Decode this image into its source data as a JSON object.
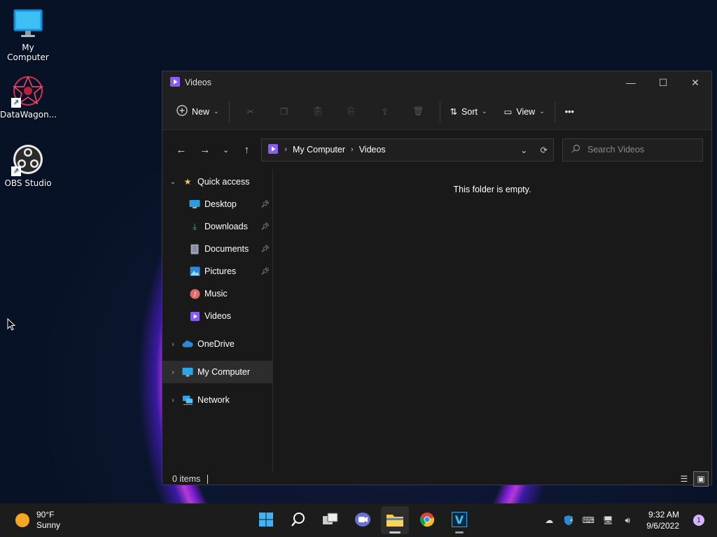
{
  "desktop": {
    "icons": [
      {
        "label": "My Computer",
        "icon": "monitor-icon"
      },
      {
        "label": "DataWagon...",
        "icon": "datawagon-app-icon"
      },
      {
        "label": "OBS Studio",
        "icon": "obs-studio-icon"
      }
    ]
  },
  "window": {
    "title": "Videos",
    "title_icon": "videos-folder-icon",
    "controls": {
      "minimize": "—",
      "maximize": "☐",
      "close": "✕"
    },
    "commandbar": {
      "new_label": "New",
      "sort_label": "Sort",
      "view_label": "View",
      "more_label": "•••",
      "disabled_actions": [
        "cut-icon",
        "copy-icon",
        "paste-icon",
        "rename-icon",
        "share-icon",
        "delete-icon"
      ]
    },
    "address": {
      "crumbs": [
        "My Computer",
        "Videos"
      ],
      "separator": "›"
    },
    "search": {
      "placeholder": "Search Videos"
    },
    "navpane": {
      "quick_access": "Quick access",
      "items": [
        {
          "label": "Desktop",
          "icon": "desktop-folder-icon",
          "pinned": true
        },
        {
          "label": "Downloads",
          "icon": "downloads-folder-icon",
          "pinned": true
        },
        {
          "label": "Documents",
          "icon": "documents-folder-icon",
          "pinned": true
        },
        {
          "label": "Pictures",
          "icon": "pictures-folder-icon",
          "pinned": true
        },
        {
          "label": "Music",
          "icon": "music-folder-icon",
          "pinned": false
        },
        {
          "label": "Videos",
          "icon": "videos-folder-icon",
          "pinned": false
        }
      ],
      "onedrive": "OneDrive",
      "my_computer": "My Computer",
      "network": "Network"
    },
    "content": {
      "empty_message": "This folder is empty."
    },
    "status": {
      "items_count": "0 items"
    }
  },
  "taskbar": {
    "weather": {
      "temperature": "90°F",
      "condition": "Sunny"
    },
    "apps": [
      "start-icon",
      "search-icon",
      "task-view-icon",
      "chat-icon",
      "file-explorer-icon",
      "chrome-icon",
      "v-app-icon"
    ],
    "clock": {
      "time": "9:32 AM",
      "date": "9/6/2022"
    },
    "notification_count": "1"
  },
  "colors": {
    "window_bg": "#191919",
    "titlebar_bg": "#202020",
    "taskbar_bg": "#1c1c1c",
    "accent": "#8a5cf6",
    "folder_yellow": "#f7c948"
  }
}
